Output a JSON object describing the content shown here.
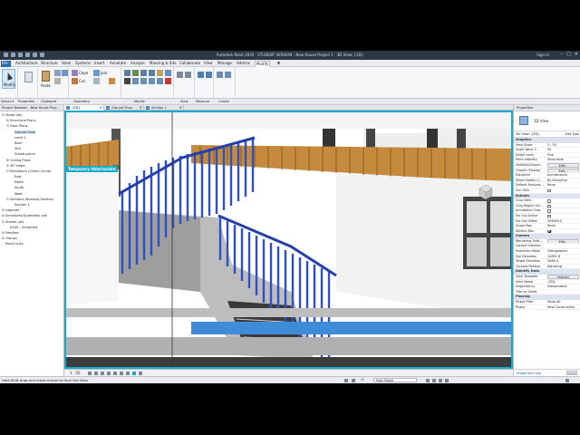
{
  "titlebar": {
    "title": "Autodesk Revit 2020 - STUDENT VERSION - New House Project 1 - 3D View: {3D}",
    "right": "Sign In"
  },
  "menu": {
    "tabs": [
      "File",
      "Architecture",
      "Structure",
      "Steel",
      "Systems",
      "Insert",
      "Annotate",
      "Analyze",
      "Massing & Site",
      "Collaborate",
      "View",
      "Manage",
      "Add-Ins",
      "Modify",
      "▼"
    ],
    "active": "Modify"
  },
  "ribbon": {
    "modify_label": "Modify",
    "groups": [
      "Properties",
      "Clipboard",
      "Geometry",
      "Modify",
      "View",
      "Measure",
      "Create"
    ],
    "geometry_items": [
      "Cope",
      "Cut",
      "Join"
    ],
    "clipboard_item": "Paste"
  },
  "strip": {
    "select": "Select ▾",
    "properties": "Properties",
    "clipboard": "Clipboard",
    "geometry": "Geometry",
    "modify": "Modify",
    "view": "View",
    "measure": "Measure",
    "create": "Create"
  },
  "browser": {
    "header": "Project Browser - New House Proj...",
    "nodes": [
      {
        "indent": 0,
        "tw": "⊟",
        "text": "Views (all)"
      },
      {
        "indent": 1,
        "tw": "⊞",
        "text": "Structural Plans"
      },
      {
        "indent": 1,
        "tw": "⊟",
        "text": "Floor Plans"
      },
      {
        "indent": 2,
        "tw": "",
        "text": "Ground Floor",
        "selected": true
      },
      {
        "indent": 2,
        "tw": "",
        "text": "Level 1"
      },
      {
        "indent": 2,
        "tw": "",
        "text": "Roof"
      },
      {
        "indent": 2,
        "tw": "",
        "text": "Site"
      },
      {
        "indent": 2,
        "tw": "",
        "text": "Substructure"
      },
      {
        "indent": 1,
        "tw": "⊞",
        "text": "Ceiling Plans"
      },
      {
        "indent": 1,
        "tw": "⊞",
        "text": "3D Views"
      },
      {
        "indent": 1,
        "tw": "⊟",
        "text": "Elevations (12mm Circle)"
      },
      {
        "indent": 2,
        "tw": "",
        "text": "East"
      },
      {
        "indent": 2,
        "tw": "",
        "text": "North"
      },
      {
        "indent": 2,
        "tw": "",
        "text": "South"
      },
      {
        "indent": 2,
        "tw": "",
        "text": "West"
      },
      {
        "indent": 1,
        "tw": "⊟",
        "text": "Sections (Building Section)"
      },
      {
        "indent": 2,
        "tw": "",
        "text": "Section 1"
      },
      {
        "indent": 0,
        "tw": "⊞",
        "text": "Legends"
      },
      {
        "indent": 0,
        "tw": "⊞",
        "text": "Schedules/Quantities (all)"
      },
      {
        "indent": 0,
        "tw": "⊟",
        "text": "Sheets (all)"
      },
      {
        "indent": 1,
        "tw": "",
        "text": "A100 - Unnamed"
      },
      {
        "indent": 0,
        "tw": "⊞",
        "text": "Families"
      },
      {
        "indent": 0,
        "tw": "⊞",
        "text": "Groups"
      },
      {
        "indent": 0,
        "tw": "",
        "text": "Revit Links"
      }
    ]
  },
  "viewtabs": [
    {
      "label": "{3D}",
      "active": true
    },
    {
      "label": "Ground Floor",
      "active": false
    },
    {
      "label": "Section 1",
      "active": false
    }
  ],
  "viewport": {
    "banner": "Temporary Hide/Isolate",
    "scale": "1 : 50"
  },
  "properties": {
    "header": "Properties",
    "type_name": "3D View",
    "filter": "3D View: {3D}",
    "edit_type": "Edit Type",
    "sections": [
      {
        "category": "Graphics",
        "rows": [
          {
            "k": "View Scale",
            "v": "1 : 50"
          },
          {
            "k": "Scale Value  1:",
            "v": "50"
          },
          {
            "k": "Detail Level",
            "v": "Fine"
          },
          {
            "k": "Parts Visibility",
            "v": "Show Both"
          },
          {
            "k": "Visibility/Graphi...",
            "v": "Edit...",
            "btn": true
          },
          {
            "k": "Graphic Display...",
            "v": "Edit...",
            "btn": true
          },
          {
            "k": "Discipline",
            "v": "Architectural"
          },
          {
            "k": "Show Hidden Li...",
            "v": "By Discipline"
          },
          {
            "k": "Default Analysis...",
            "v": "None"
          },
          {
            "k": "Sun Path",
            "chk": false
          }
        ]
      },
      {
        "category": "Extents",
        "rows": [
          {
            "k": "Crop View",
            "chk": false
          },
          {
            "k": "Crop Region Vis...",
            "chk": false
          },
          {
            "k": "Annotation Crop",
            "chk": false
          },
          {
            "k": "Far Clip Active",
            "chk": false
          },
          {
            "k": "Far Clip Offset",
            "v": "304800.0"
          },
          {
            "k": "Scope Box",
            "v": "None"
          },
          {
            "k": "Section Box",
            "chk": true
          }
        ]
      },
      {
        "category": "Camera",
        "rows": [
          {
            "k": "Rendering Setti...",
            "v": "Edit...",
            "btn": true
          },
          {
            "k": "Locked Orientat...",
            "v": ""
          },
          {
            "k": "Projection Mode",
            "v": "Orthographic"
          },
          {
            "k": "Eye Elevation",
            "v": "12851.8"
          },
          {
            "k": "Target Elevation",
            "v": "2066.4"
          },
          {
            "k": "Camera Position",
            "v": "Adjusting"
          }
        ]
      },
      {
        "category": "Identity Data",
        "rows": [
          {
            "k": "View Template",
            "v": "<None>",
            "btn": true
          },
          {
            "k": "View Name",
            "v": "{3D}"
          },
          {
            "k": "Dependency",
            "v": "Independent"
          },
          {
            "k": "Title on Sheet",
            "v": ""
          }
        ]
      },
      {
        "category": "Phasing",
        "rows": [
          {
            "k": "Phase Filter",
            "v": "Show All"
          },
          {
            "k": "Phase",
            "v": "New Construction"
          }
        ]
      }
    ],
    "help": "Properties help",
    "apply": "Apply"
  },
  "status": {
    "message": "Hold Shift-drag and move mouse to Spin the View",
    "zero": ":0",
    "model": "Main Model"
  },
  "colors": {
    "accent": "#1aa9c7",
    "railing": "#2f4fc4",
    "timber": "#c58a3c"
  }
}
